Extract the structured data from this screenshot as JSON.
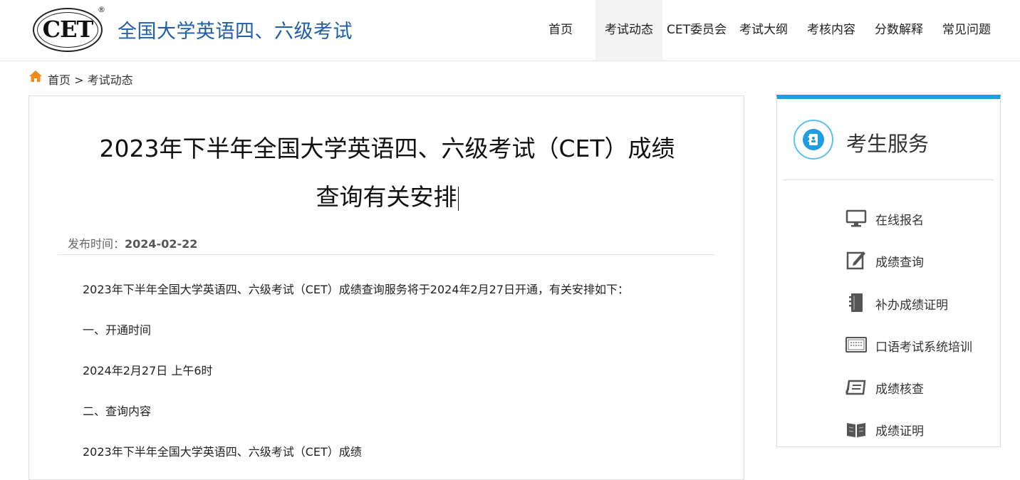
{
  "header": {
    "logo_text": "CET",
    "logo_reg": "®",
    "site_title": "全国大学英语四、六级考试"
  },
  "nav": {
    "items": [
      {
        "label": "首页"
      },
      {
        "label": "考试动态",
        "active": true
      },
      {
        "label": "CET委员会"
      },
      {
        "label": "考试大纲"
      },
      {
        "label": "考核内容"
      },
      {
        "label": "分数解释"
      },
      {
        "label": "常见问题"
      }
    ]
  },
  "breadcrumb": {
    "home": "首页",
    "separator": " > ",
    "current": "考试动态"
  },
  "article": {
    "title_line1": "2023年下半年全国大学英语四、六级考试（CET）成绩",
    "title_line2": "查询有关安排",
    "published_label": "发布时间：",
    "published_date": "2024-02-22",
    "paragraphs": [
      "2023年下半年全国大学英语四、六级考试（CET）成绩查询服务将于2024年2月27日开通，有关安排如下：",
      "一、开通时间",
      "2024年2月27日 上午6时",
      "二、查询内容",
      "2023年下半年全国大学英语四、六级考试（CET）成绩"
    ]
  },
  "sidebar": {
    "title": "考生服务",
    "accent_color": "#1e9ee0",
    "items": [
      {
        "label": "在线报名",
        "icon": "monitor-icon"
      },
      {
        "label": "成绩查询",
        "icon": "edit-icon"
      },
      {
        "label": "补办成绩证明",
        "icon": "notebook-icon"
      },
      {
        "label": "口语考试系统培训",
        "icon": "keyboard-icon"
      },
      {
        "label": "成绩核查",
        "icon": "scroll-icon"
      },
      {
        "label": "成绩证明",
        "icon": "open-book-icon"
      }
    ]
  }
}
